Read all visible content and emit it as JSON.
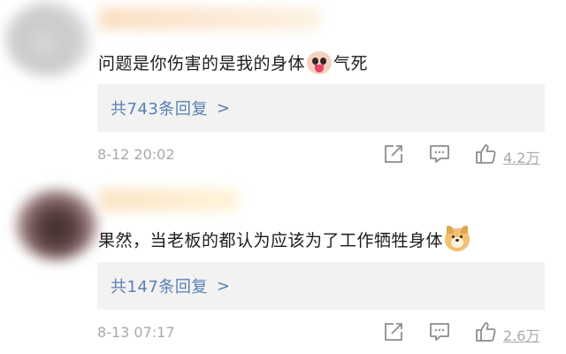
{
  "comments": [
    {
      "text": "问题是你伤害的是我的身体",
      "suffix": "气死",
      "emoji": "angry-tongue-emoji",
      "replies_label": "共743条回复",
      "replies_chevron": ">",
      "timestamp": "8-12 20:02",
      "likes": "4.2万"
    },
    {
      "text": "果然，当老板的都认为应该为了工作牺牲身体",
      "suffix": "",
      "emoji": "doge-emoji",
      "replies_label": "共147条回复",
      "replies_chevron": ">",
      "timestamp": "8-13 07:17",
      "likes": "2.6万"
    }
  ],
  "icons": {
    "share": "share-icon",
    "comment": "comment-icon",
    "like": "thumbs-up-icon"
  },
  "colors": {
    "link": "#5a7fb3",
    "meta": "#a9a9a9",
    "text": "#1d1d1d",
    "reply_bg": "#f2f2f2"
  }
}
